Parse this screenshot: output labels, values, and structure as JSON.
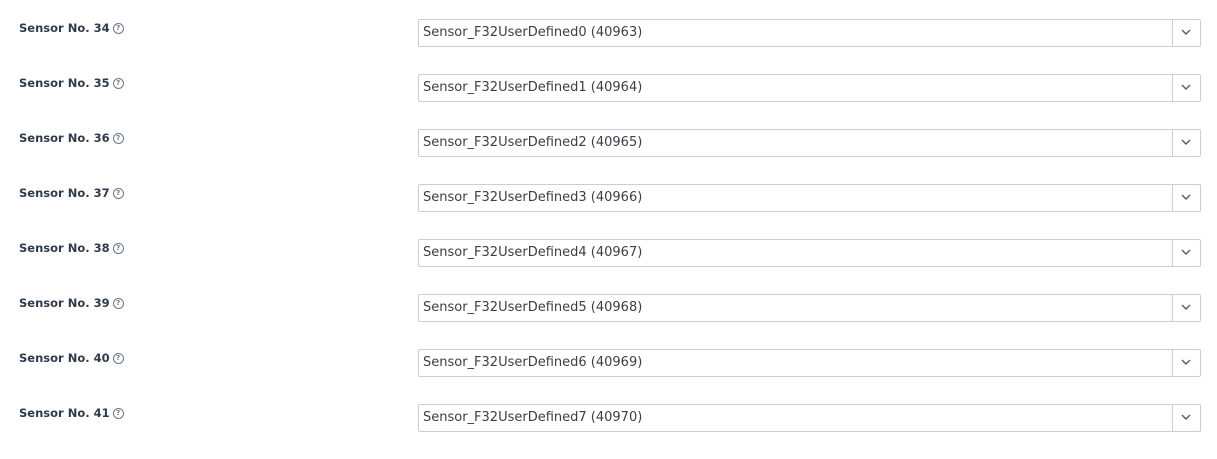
{
  "fields": [
    {
      "label": "Sensor No. 34",
      "value": "Sensor_F32UserDefined0 (40963)"
    },
    {
      "label": "Sensor No. 35",
      "value": "Sensor_F32UserDefined1 (40964)"
    },
    {
      "label": "Sensor No. 36",
      "value": "Sensor_F32UserDefined2 (40965)"
    },
    {
      "label": "Sensor No. 37",
      "value": "Sensor_F32UserDefined3 (40966)"
    },
    {
      "label": "Sensor No. 38",
      "value": "Sensor_F32UserDefined4 (40967)"
    },
    {
      "label": "Sensor No. 39",
      "value": "Sensor_F32UserDefined5 (40968)"
    },
    {
      "label": "Sensor No. 40",
      "value": "Sensor_F32UserDefined6 (40969)"
    },
    {
      "label": "Sensor No. 41",
      "value": "Sensor_F32UserDefined7 (40970)"
    }
  ],
  "icons": {
    "help": "help-circle-icon",
    "dropdown": "chevron-down-icon"
  },
  "colors": {
    "label_text": "#2f3b4c",
    "select_border": "#c9cfd7",
    "select_text": "#3a3f45",
    "help_icon": "#6a7585"
  }
}
